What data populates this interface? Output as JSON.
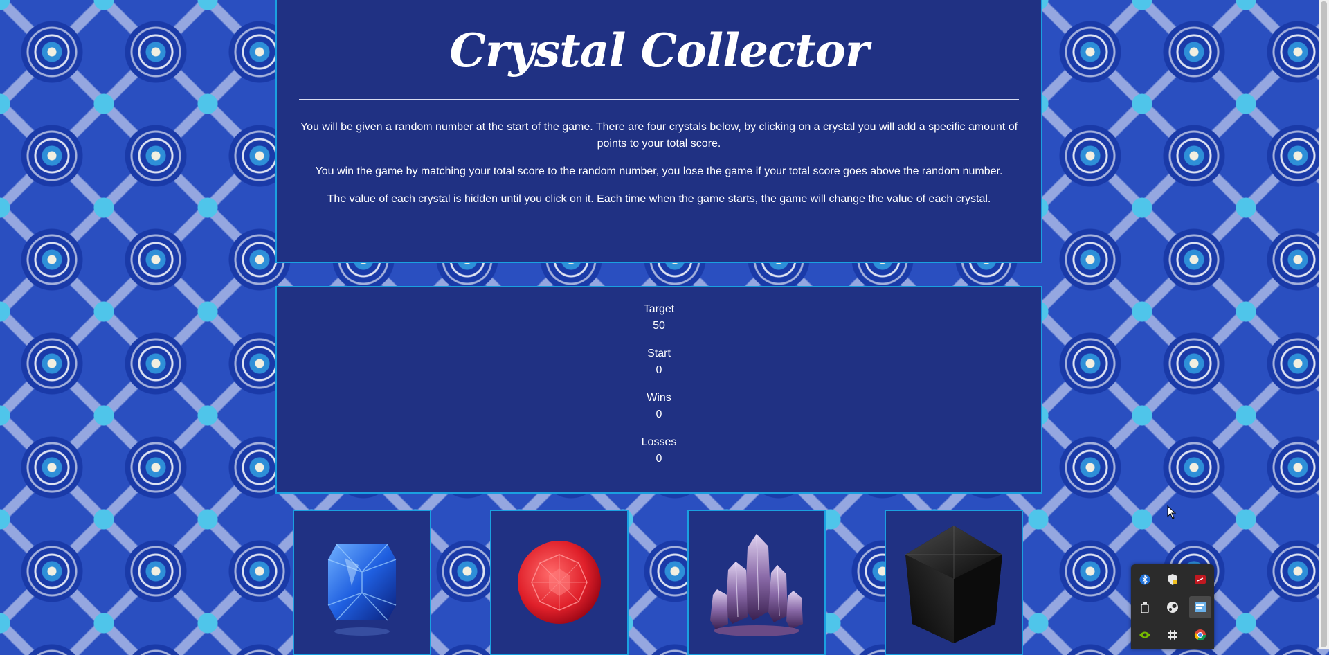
{
  "game": {
    "title": "Crystal Collector",
    "instructions": [
      "You will be given a random number at the start of the game. There are four crystals below, by clicking on a crystal you will add a specific amount of points to your total score.",
      "You win the game by matching your total score to the random number, you lose the game if your total score goes above the random number.",
      "The value of each crystal is hidden until you click on it. Each time when the game starts, the game will change the value of each crystal."
    ]
  },
  "stats": {
    "target_label": "Target",
    "target_value": "50",
    "start_label": "Start",
    "start_value": "0",
    "wins_label": "Wins",
    "wins_value": "0",
    "losses_label": "Losses",
    "losses_value": "0"
  },
  "crystals": [
    {
      "name": "blue-sapphire",
      "color": "#1f5fe0"
    },
    {
      "name": "red-ruby",
      "color": "#e0202a"
    },
    {
      "name": "purple-amethyst",
      "color": "#8a6aa8"
    },
    {
      "name": "black-cube",
      "color": "#111111"
    }
  ],
  "tray_icons": [
    "bluetooth-icon",
    "security-shield-icon",
    "app-red-icon",
    "usb-drive-icon",
    "steam-icon",
    "network-app-icon",
    "nvidia-icon",
    "slack-icon",
    "chrome-icon"
  ],
  "colors": {
    "panel": "#203183",
    "border": "#1aa0e0",
    "text": "#ffffff"
  }
}
